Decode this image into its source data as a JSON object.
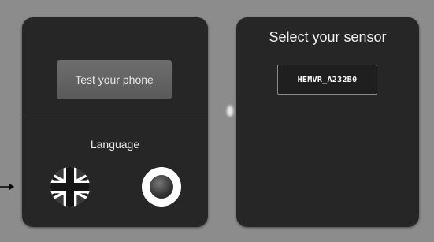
{
  "left_panel": {
    "test_button_label": "Test your phone",
    "language_label": "Language",
    "languages": [
      {
        "icon": "uk-flag-icon"
      },
      {
        "icon": "radio-selected-icon"
      }
    ]
  },
  "right_panel": {
    "title": "Select your sensor",
    "sensors": [
      "HEMVR_A232B0"
    ]
  },
  "colors": {
    "background": "#8c8c8c",
    "panel": "#262626",
    "button": "#666666",
    "text": "#e8e8e8"
  }
}
